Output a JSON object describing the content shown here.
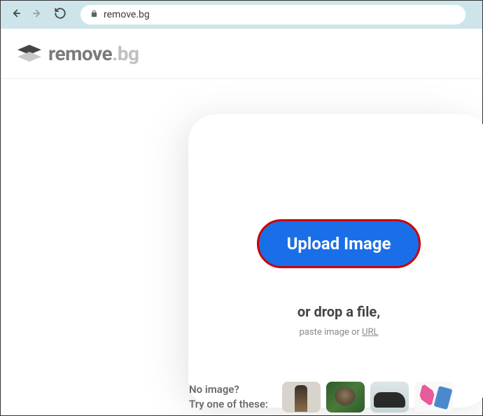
{
  "browser": {
    "url": "remove.bg"
  },
  "header": {
    "logo_main": "remove",
    "logo_suffix": ".bg"
  },
  "upload": {
    "button_label": "Upload Image",
    "drop_text": "or drop a file,",
    "paste_prefix": "paste image or ",
    "paste_url": "URL"
  },
  "samples": {
    "line1": "No image?",
    "line2": "Try one of these:"
  }
}
